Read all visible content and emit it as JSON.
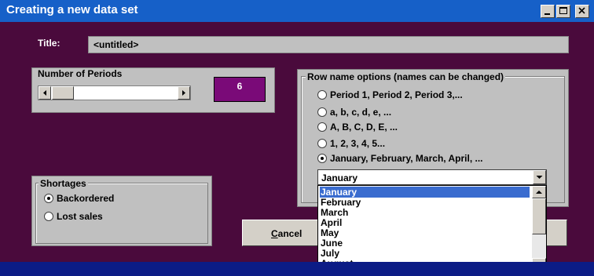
{
  "window": {
    "title": "Creating a new data set",
    "controls": [
      "minimize-icon",
      "maximize-icon",
      "close-icon"
    ]
  },
  "title_field": {
    "label": "Title:",
    "value": "<untitled>"
  },
  "periods": {
    "label": "Number of Periods",
    "value": "6"
  },
  "row_names": {
    "label": "Row name options (names can be changed)",
    "options": [
      {
        "label": "Period 1, Period 2, Period 3,...",
        "checked": false
      },
      {
        "label": "a, b, c, d, e, ...",
        "checked": false
      },
      {
        "label": "A, B, C, D, E, ...",
        "checked": false
      },
      {
        "label": "1, 2, 3, 4, 5...",
        "checked": false
      },
      {
        "label": "January, February, March, April, ...",
        "checked": true
      }
    ]
  },
  "month_combo": {
    "value": "January",
    "options": [
      "January",
      "February",
      "March",
      "April",
      "May",
      "June",
      "July",
      "August"
    ],
    "selected_index": 0
  },
  "shortages": {
    "label": "Shortages",
    "options": [
      {
        "label": "Backordered",
        "checked": true
      },
      {
        "label": "Lost sales",
        "checked": false
      }
    ]
  },
  "buttons": {
    "cancel_mnemonic": "C",
    "cancel_rest": "ancel"
  },
  "colors": {
    "background": "#4a0a3c",
    "titlebar": "#1660c8",
    "accent": "#7a0a78",
    "selection": "#3a6ccf"
  }
}
